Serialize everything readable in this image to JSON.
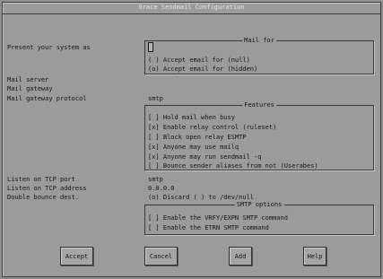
{
  "window": {
    "title": "Grace Sendmail Configuration"
  },
  "labels": {
    "present_system": "Present your system as",
    "mail_server": "Mail server",
    "mail_gateway": "Mail gateway",
    "mail_gateway_protocol": "Mail gateway protocol",
    "listen_tcp_port": "Listen on TCP port",
    "listen_tcp_address": "Listen on TCP address",
    "double_bounce": "Double bounce dest."
  },
  "values": {
    "present_system": "",
    "mail_gateway_protocol": "smtp",
    "listen_tcp_port": "smtp",
    "listen_tcp_address": "0.0.0.0",
    "double_bounce": "(o) Discard    ( ) to /dev/null"
  },
  "mail_for": {
    "title": "Mail for",
    "options": [
      "( ) Accept email for (null)",
      "(o) Accept email for (hidden)"
    ]
  },
  "features": {
    "title": "Features",
    "options": [
      "[ ] Hold mail when busy",
      "[x] Enable relay control (ruleset)",
      "[ ] Block open relay ESMTP",
      "[x] Anyone may use mailq",
      "[x] Anyone may run sendmail -q",
      "[ ] Bounce sender aliases from not (Userabes)"
    ]
  },
  "smtp_options": {
    "title": "SMTP options",
    "options": [
      "[ ] Enable the VRFY/EXPN SMTP command",
      "[ ] Enable the ETRN SMTP command"
    ]
  },
  "buttons": {
    "accept": "Accept",
    "cancel": "Cancel",
    "add": "Add",
    "help": "Help"
  }
}
